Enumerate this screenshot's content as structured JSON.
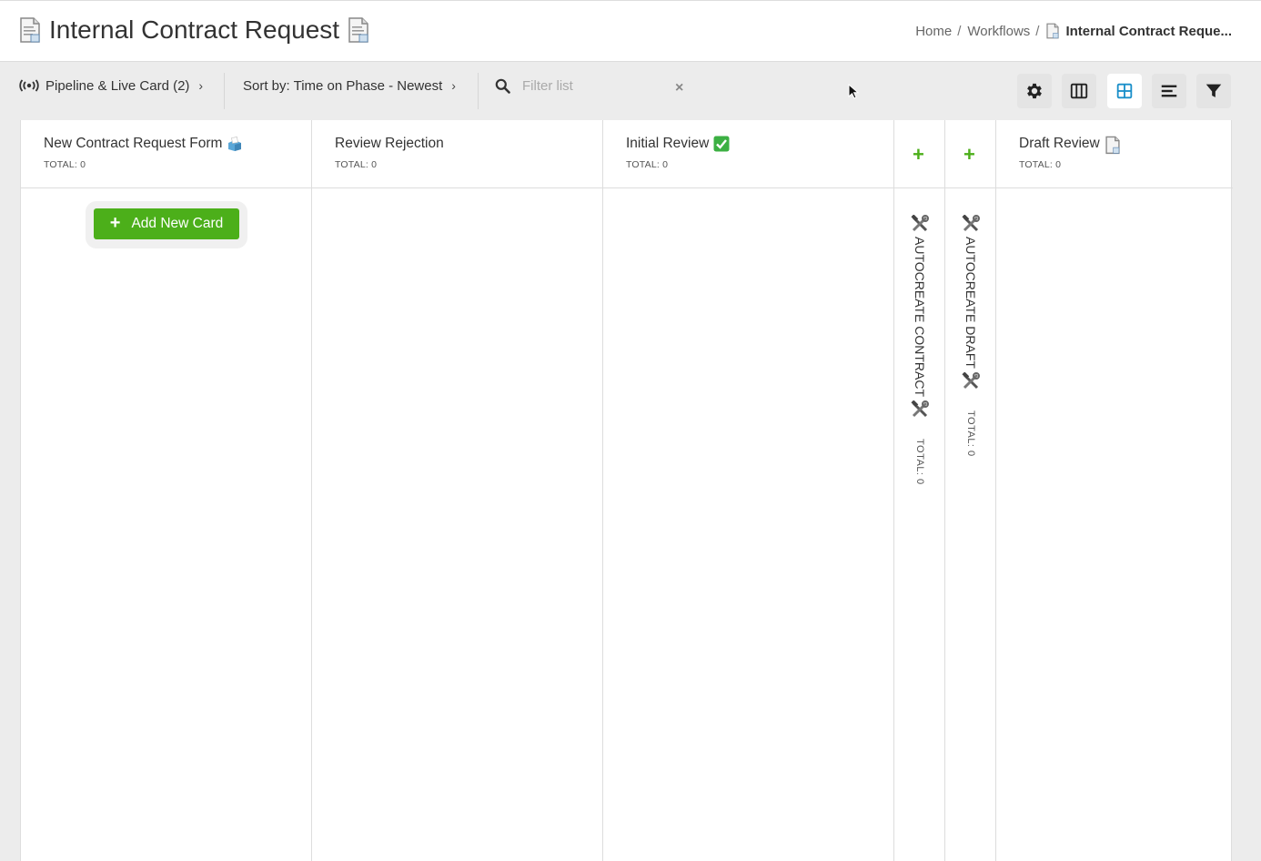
{
  "header": {
    "title": "Internal Contract Request",
    "title_icon": "document-icon",
    "breadcrumb": {
      "home": "Home",
      "workflows": "Workflows",
      "sep": "/",
      "current": "Internal Contract Reque..."
    }
  },
  "toolbar": {
    "pipeline_label": "Pipeline & Live Card (2)",
    "sort_label": "Sort by: Time on Phase - Newest",
    "filter_placeholder": "Filter list",
    "filter_value": "",
    "clear": "×",
    "view_buttons": [
      "settings-icon",
      "columns-icon",
      "grid-icon",
      "list-icon",
      "filter-icon"
    ],
    "active_view": "grid-icon"
  },
  "columns": [
    {
      "title": "New Contract Request Form",
      "emoji": "ballot-box-icon",
      "total": "TOTAL: 0"
    },
    {
      "title": "Review Rejection",
      "total": "TOTAL: 0"
    },
    {
      "title": "Initial Review",
      "emoji": "check-mark-icon",
      "total": "TOTAL: 0"
    },
    {
      "title": "AUTOCREATE CONTRACT",
      "icon": "hammer-wrench-icon",
      "total": "TOTAL: 0",
      "collapsed": true
    },
    {
      "title": "AUTOCREATE DRAFT",
      "icon": "hammer-wrench-icon",
      "total": "TOTAL: 0",
      "collapsed": true
    },
    {
      "title": "Draft Review",
      "emoji": "document-icon",
      "total": "TOTAL: 0"
    }
  ],
  "add_card_label": "Add New Card",
  "colors": {
    "accent_green": "#4caf1a",
    "active_view": "#1a8fc9",
    "board_bg": "#ffffff",
    "page_bg": "#ececec"
  }
}
